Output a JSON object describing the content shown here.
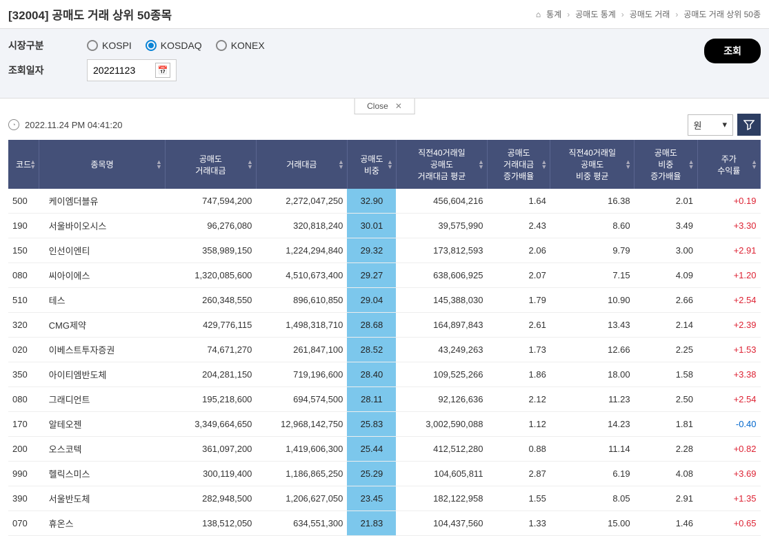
{
  "header": {
    "title": "[32004] 공매도 거래 상위 50종목",
    "breadcrumb": [
      "통계",
      "공매도 통계",
      "공매도 거래",
      "공매도 거래 상위 50종"
    ]
  },
  "filter": {
    "market_label": "시장구분",
    "date_label": "조회일자",
    "date_value": "20221123",
    "radio_options": [
      {
        "label": "KOSPI",
        "checked": false
      },
      {
        "label": "KOSDAQ",
        "checked": true
      },
      {
        "label": "KONEX",
        "checked": false
      }
    ],
    "search_btn": "조회",
    "close_label": "Close"
  },
  "toolbar": {
    "timestamp": "2022.11.24 PM 04:41:20",
    "unit": "원"
  },
  "table": {
    "columns": [
      "코드",
      "종목명",
      "공매도\n거래대금",
      "거래대금",
      "공매도\n비중",
      "직전40거래일\n공매도\n거래대금 평균",
      "공매도\n거래대금\n증가배율",
      "직전40거래일\n공매도\n비중 평균",
      "공매도\n비중\n증가배율",
      "주가\n수익률"
    ],
    "rows": [
      {
        "code": "500",
        "name": "케이엠더블유",
        "v1": "747,594,200",
        "v2": "2,272,047,250",
        "v3": "32.90",
        "v4": "456,604,216",
        "v5": "1.64",
        "v6": "16.38",
        "v7": "2.01",
        "v8": "+0.19",
        "pos": true
      },
      {
        "code": "190",
        "name": "서울바이오시스",
        "v1": "96,276,080",
        "v2": "320,818,240",
        "v3": "30.01",
        "v4": "39,575,990",
        "v5": "2.43",
        "v6": "8.60",
        "v7": "3.49",
        "v8": "+3.30",
        "pos": true
      },
      {
        "code": "150",
        "name": "인선이엔티",
        "v1": "358,989,150",
        "v2": "1,224,294,840",
        "v3": "29.32",
        "v4": "173,812,593",
        "v5": "2.06",
        "v6": "9.79",
        "v7": "3.00",
        "v8": "+2.91",
        "pos": true
      },
      {
        "code": "080",
        "name": "씨아이에스",
        "v1": "1,320,085,600",
        "v2": "4,510,673,400",
        "v3": "29.27",
        "v4": "638,606,925",
        "v5": "2.07",
        "v6": "7.15",
        "v7": "4.09",
        "v8": "+1.20",
        "pos": true
      },
      {
        "code": "510",
        "name": "테스",
        "v1": "260,348,550",
        "v2": "896,610,850",
        "v3": "29.04",
        "v4": "145,388,030",
        "v5": "1.79",
        "v6": "10.90",
        "v7": "2.66",
        "v8": "+2.54",
        "pos": true
      },
      {
        "code": "320",
        "name": "CMG제약",
        "v1": "429,776,115",
        "v2": "1,498,318,710",
        "v3": "28.68",
        "v4": "164,897,843",
        "v5": "2.61",
        "v6": "13.43",
        "v7": "2.14",
        "v8": "+2.39",
        "pos": true
      },
      {
        "code": "020",
        "name": "이베스트투자증권",
        "v1": "74,671,270",
        "v2": "261,847,100",
        "v3": "28.52",
        "v4": "43,249,263",
        "v5": "1.73",
        "v6": "12.66",
        "v7": "2.25",
        "v8": "+1.53",
        "pos": true
      },
      {
        "code": "350",
        "name": "아이티엠반도체",
        "v1": "204,281,150",
        "v2": "719,196,600",
        "v3": "28.40",
        "v4": "109,525,266",
        "v5": "1.86",
        "v6": "18.00",
        "v7": "1.58",
        "v8": "+3.38",
        "pos": true
      },
      {
        "code": "080",
        "name": "그래디언트",
        "v1": "195,218,600",
        "v2": "694,574,500",
        "v3": "28.11",
        "v4": "92,126,636",
        "v5": "2.12",
        "v6": "11.23",
        "v7": "2.50",
        "v8": "+2.54",
        "pos": true
      },
      {
        "code": "170",
        "name": "알테오젠",
        "v1": "3,349,664,650",
        "v2": "12,968,142,750",
        "v3": "25.83",
        "v4": "3,002,590,088",
        "v5": "1.12",
        "v6": "14.23",
        "v7": "1.81",
        "v8": "-0.40",
        "pos": false
      },
      {
        "code": "200",
        "name": "오스코텍",
        "v1": "361,097,200",
        "v2": "1,419,606,300",
        "v3": "25.44",
        "v4": "412,512,280",
        "v5": "0.88",
        "v6": "11.14",
        "v7": "2.28",
        "v8": "+0.82",
        "pos": true
      },
      {
        "code": "990",
        "name": "헬릭스미스",
        "v1": "300,119,400",
        "v2": "1,186,865,250",
        "v3": "25.29",
        "v4": "104,605,811",
        "v5": "2.87",
        "v6": "6.19",
        "v7": "4.08",
        "v8": "+3.69",
        "pos": true
      },
      {
        "code": "390",
        "name": "서울반도체",
        "v1": "282,948,500",
        "v2": "1,206,627,050",
        "v3": "23.45",
        "v4": "182,122,958",
        "v5": "1.55",
        "v6": "8.05",
        "v7": "2.91",
        "v8": "+1.35",
        "pos": true
      },
      {
        "code": "070",
        "name": "휴온스",
        "v1": "138,512,050",
        "v2": "634,551,300",
        "v3": "21.83",
        "v4": "104,437,560",
        "v5": "1.33",
        "v6": "15.00",
        "v7": "1.46",
        "v8": "+0.65",
        "pos": true
      }
    ]
  }
}
